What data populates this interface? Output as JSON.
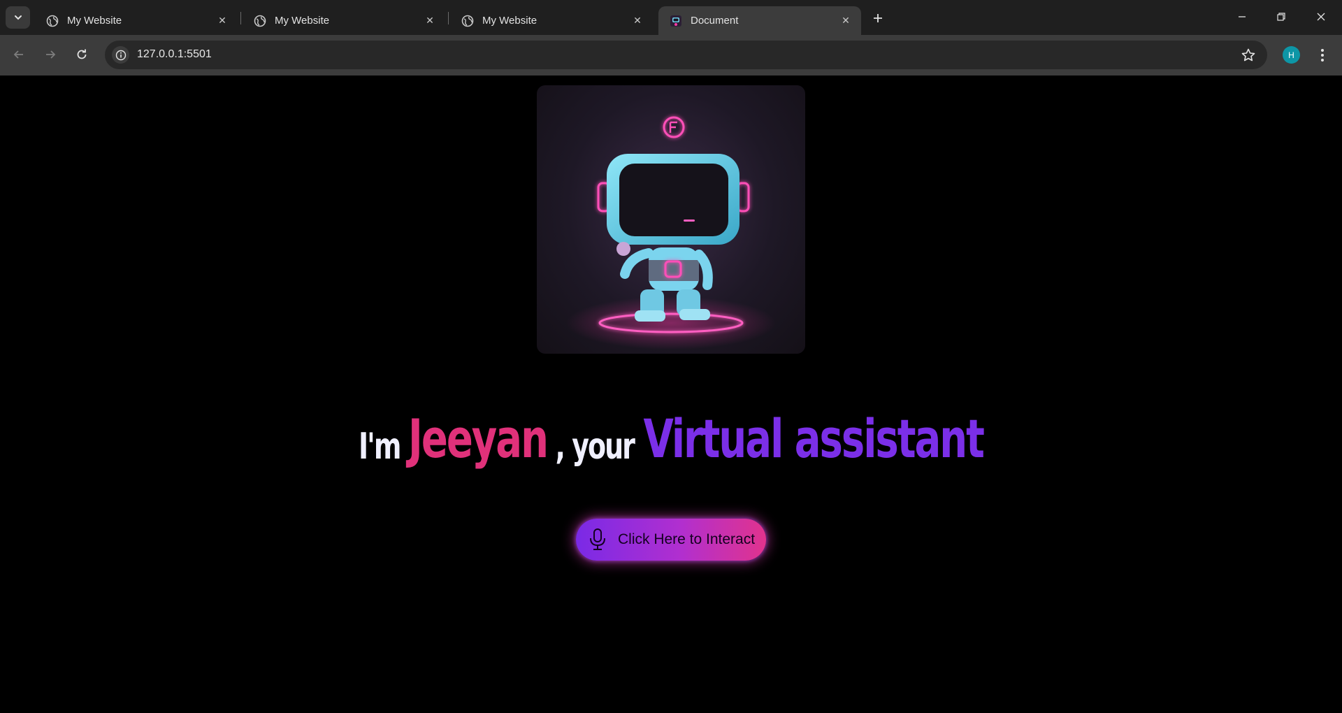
{
  "browser": {
    "tabs": [
      {
        "title": "My Website",
        "favicon": "globe-icon",
        "active": false
      },
      {
        "title": "My Website",
        "favicon": "globe-icon",
        "active": false
      },
      {
        "title": "My Website",
        "favicon": "globe-icon",
        "active": false
      },
      {
        "title": "Document",
        "favicon": "robot-favicon",
        "active": true
      }
    ],
    "close_glyph": "✕",
    "url": "127.0.0.1:5501",
    "profile_initial": "H",
    "colors": {
      "tabstrip": "#1f1f1f",
      "toolbar": "#3c3c3c",
      "omnibox": "#282828",
      "avatar": "#0d96a6"
    }
  },
  "page": {
    "hero_image": "neon-robot-illustration",
    "headline": {
      "prefix": "I'm",
      "name": "Jeeyan",
      "middle": ", your",
      "role": "Virtual assistant"
    },
    "cta": {
      "label": "Click Here to Interact",
      "icon": "microphone-icon"
    },
    "colors": {
      "name": "#e0317a",
      "role": "#7b2fe8",
      "button_start": "#7a2ae6",
      "button_end": "#e1338d"
    }
  }
}
